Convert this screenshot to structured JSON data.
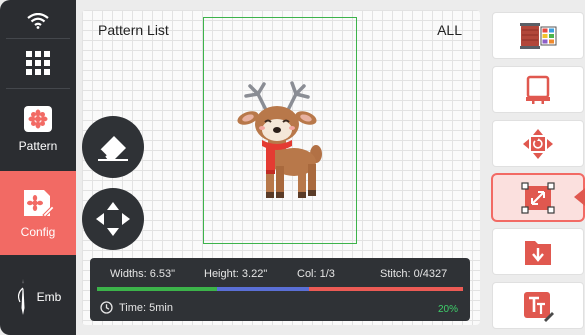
{
  "sidebar": {
    "items": [
      {
        "label": "",
        "icon": "wifi-icon"
      },
      {
        "label": "",
        "icon": "grid-menu-icon"
      },
      {
        "label": "Pattern",
        "icon": "pattern-icon"
      },
      {
        "label": "Config",
        "icon": "config-icon"
      },
      {
        "label": "Emb",
        "icon": "needle-icon"
      }
    ],
    "active": "Config"
  },
  "canvas": {
    "title": "Pattern List",
    "filter": "ALL",
    "design_icon": "reindeer-embroidery-icon"
  },
  "status": {
    "width_text": "Widths: 6.53\"",
    "height_text": "Height: 3.22\"",
    "col_text": "Col: 1/3",
    "stitch_text": "Stitch: 0/4327",
    "time_text": "Time: 5min",
    "progress_percent_text": "20%",
    "progress_percent": 20,
    "color_segments": [
      "#3cb34a",
      "#5a6fd6",
      "#ec5b55"
    ]
  },
  "toolbar": {
    "items": [
      {
        "icon": "thread-color-icon"
      },
      {
        "icon": "hoop-select-icon"
      },
      {
        "icon": "rotate-icon"
      },
      {
        "icon": "resize-icon"
      },
      {
        "icon": "save-download-icon"
      },
      {
        "icon": "text-edit-icon"
      }
    ],
    "active_index": 3
  },
  "colors": {
    "accent": "#f26a64",
    "sidebar_bg": "#2b2d31",
    "hoop_border": "#3cb34a"
  }
}
